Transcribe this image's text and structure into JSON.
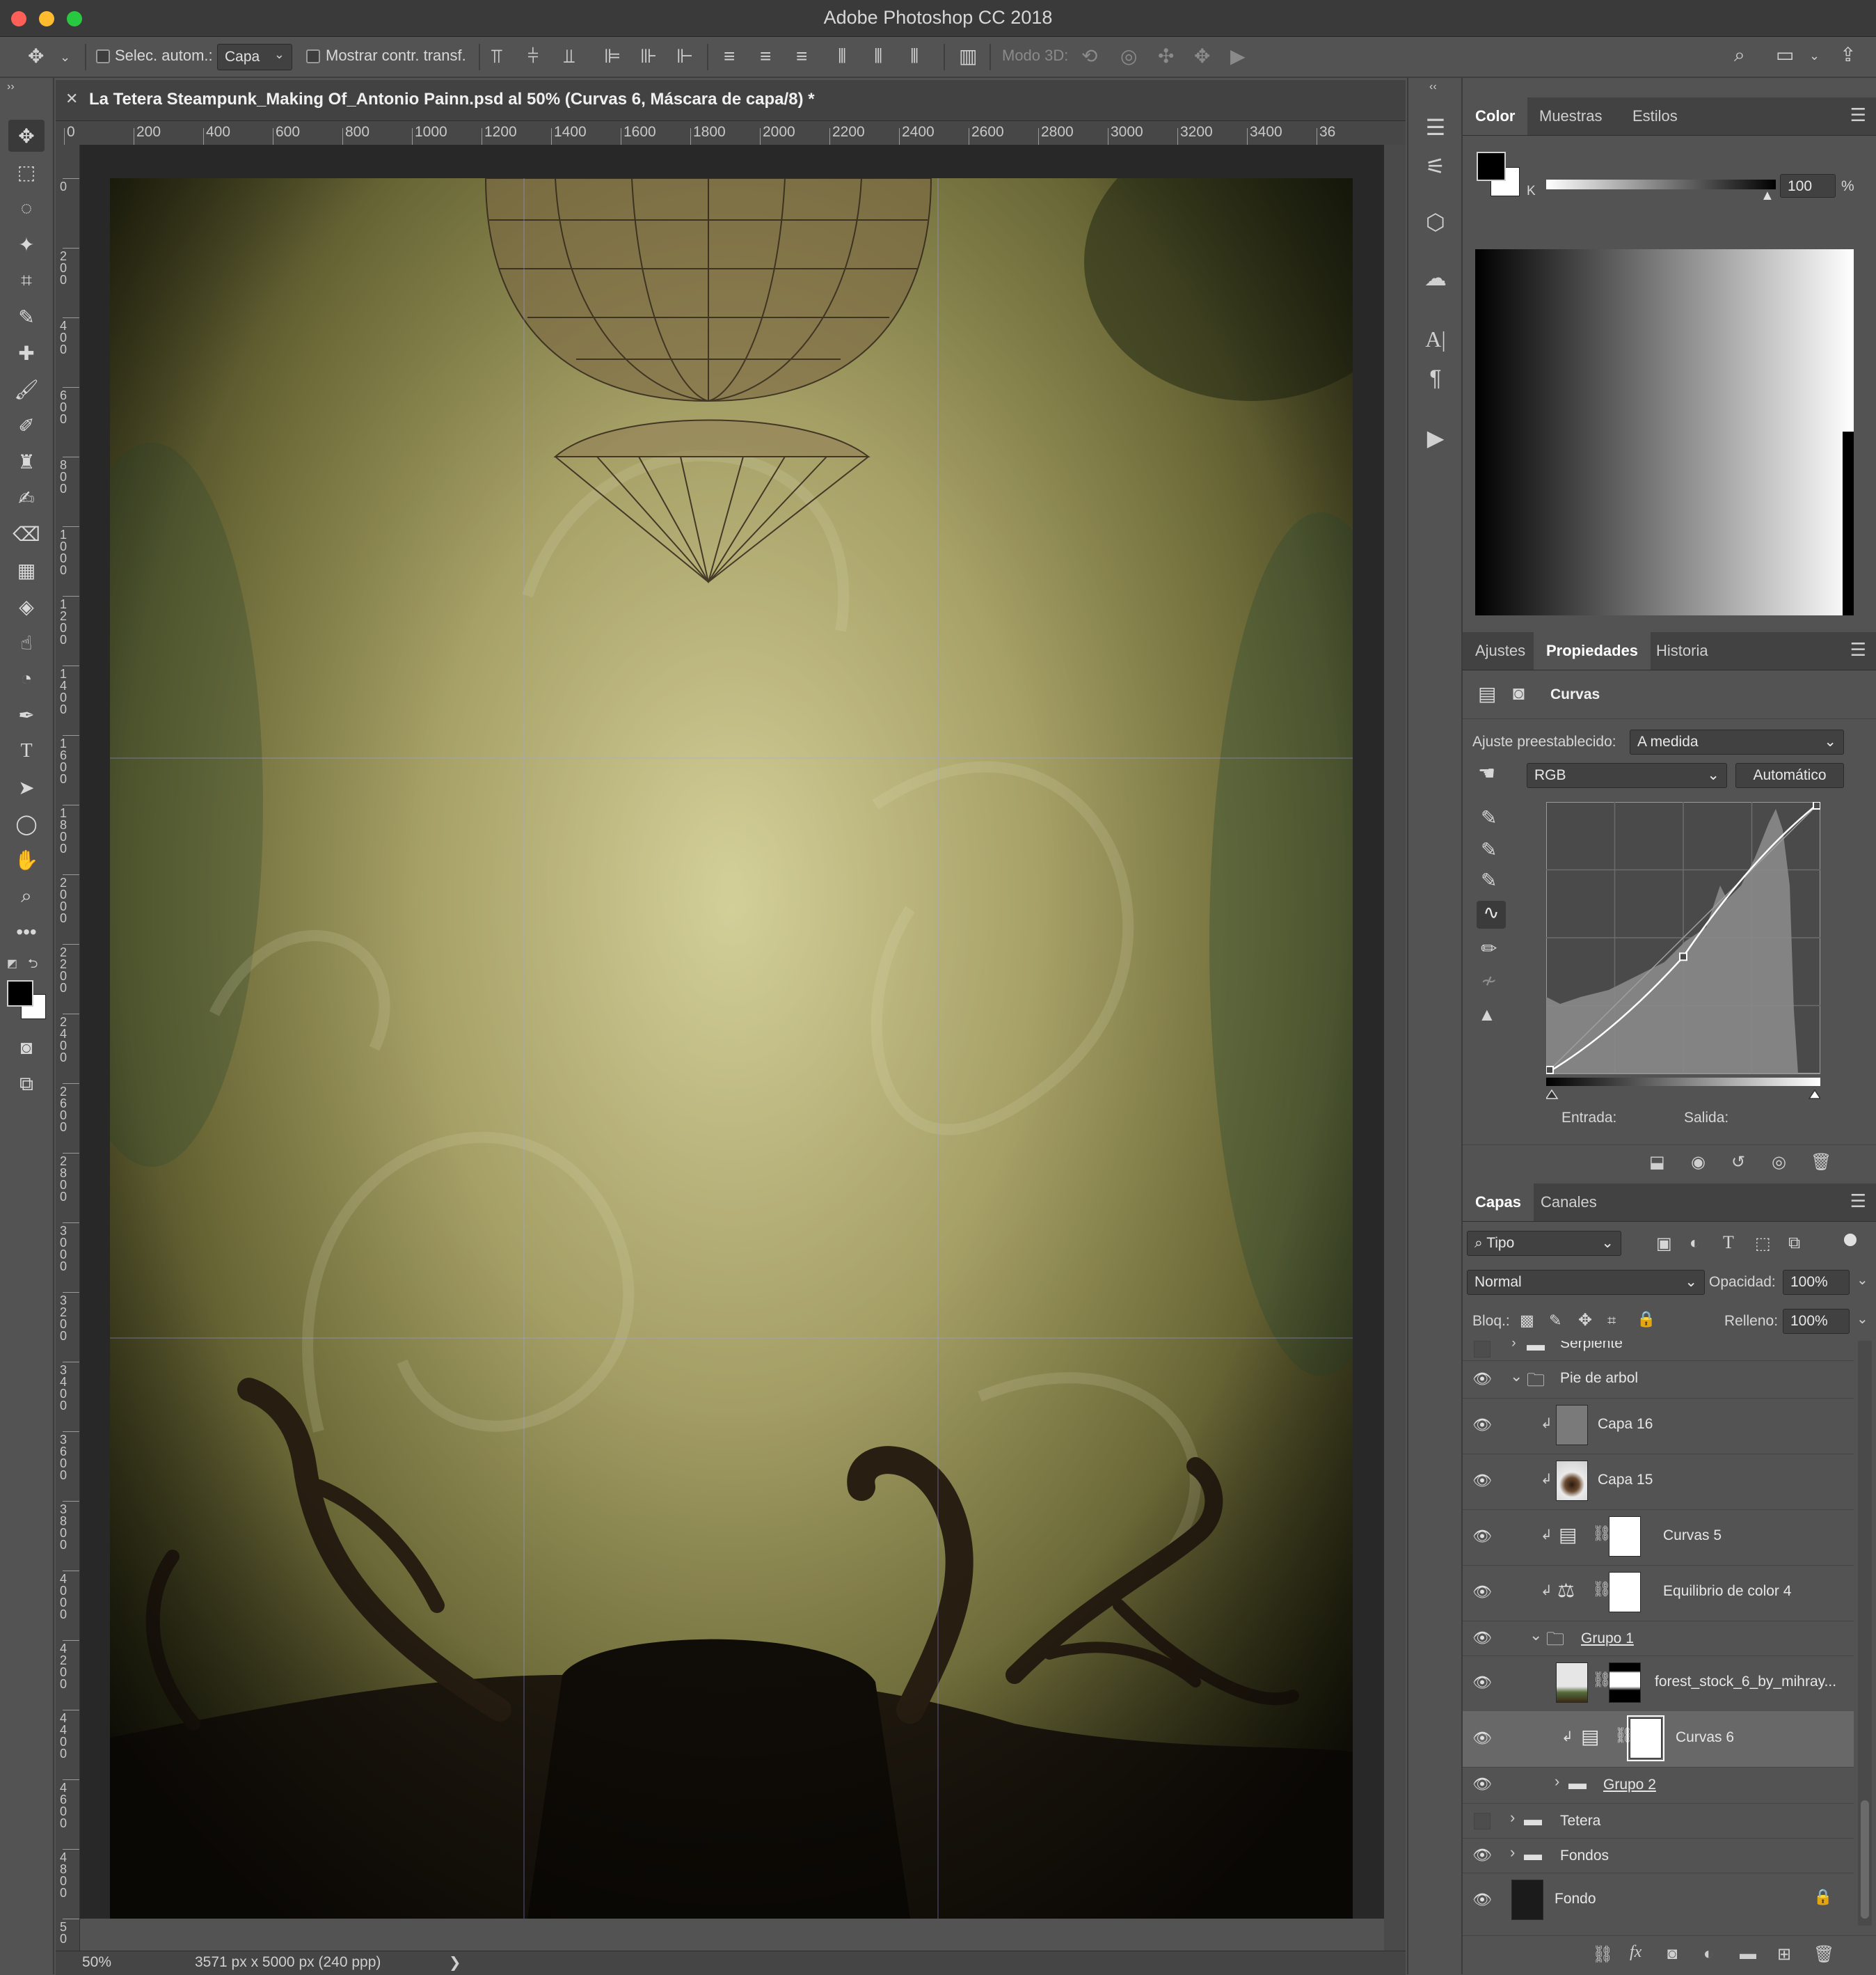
{
  "window": {
    "title": "Adobe Photoshop CC 2018"
  },
  "options_bar": {
    "auto_select_label": "Selec. autom.:",
    "auto_select_value": "Capa",
    "show_transform_label": "Mostrar contr. transf.",
    "mode_3d_label": "Modo 3D:"
  },
  "document": {
    "tab_title": "La Tetera Steampunk_Making Of_Antonio Painn.psd al 50% (Curvas 6, Máscara de capa/8) *",
    "ruler_h": [
      "0",
      "200",
      "400",
      "600",
      "800",
      "1000",
      "1200",
      "1400",
      "1600",
      "1800",
      "2000",
      "2200",
      "2400",
      "2600",
      "2800",
      "3000",
      "3200",
      "3400",
      "36"
    ],
    "ruler_v": [
      "0",
      "2 0 0",
      "4 0 0",
      "6 0 0",
      "8 0 0",
      "1 0 0 0",
      "1 2 0 0",
      "1 4 0 0",
      "1 6 0 0",
      "1 8 0 0",
      "2 0 0 0",
      "2 2 0 0",
      "2 4 0 0",
      "2 6 0 0",
      "2 8 0 0",
      "3 0 0 0",
      "3 2 0 0",
      "3 4 0 0",
      "3 6 0 0",
      "3 8 0 0",
      "4 0 0 0",
      "4 2 0 0",
      "4 4 0 0",
      "4 6 0 0",
      "4 8 0 0",
      "5 0"
    ],
    "zoom": "50%",
    "doc_info": "3571 px x 5000 px (240 ppp)"
  },
  "color_panel": {
    "tabs": [
      "Color",
      "Muestras",
      "Estilos"
    ],
    "active_tab": "Color",
    "channel_label": "K",
    "value": "100",
    "unit": "%",
    "foreground": "#000000",
    "background": "#ffffff"
  },
  "properties_panel": {
    "tabs": [
      "Ajustes",
      "Propiedades",
      "Historia"
    ],
    "active_tab": "Propiedades",
    "title": "Curvas",
    "preset_label": "Ajuste preestablecido:",
    "preset_value": "A medida",
    "channel_value": "RGB",
    "auto_button": "Automático",
    "input_label": "Entrada:",
    "output_label": "Salida:",
    "curve_points": [
      [
        0.0,
        0.0
      ],
      [
        0.5,
        0.43
      ],
      [
        1.0,
        1.0
      ]
    ]
  },
  "layers_panel": {
    "tabs": [
      "Capas",
      "Canales"
    ],
    "active_tab": "Capas",
    "filter_value": "Tipo",
    "blend_mode": "Normal",
    "opacity_label": "Opacidad:",
    "opacity_value": "100%",
    "lock_label": "Bloq.:",
    "fill_label": "Relleno:",
    "fill_value": "100%",
    "layers": [
      {
        "name": "Serpiente",
        "visible": false,
        "kind": "group-collapsed"
      },
      {
        "name": "Pie de arbol",
        "visible": true,
        "kind": "group-open"
      },
      {
        "name": "Capa 16",
        "visible": true,
        "kind": "pixel-clipped"
      },
      {
        "name": "Capa 15",
        "visible": true,
        "kind": "pixel-clipped"
      },
      {
        "name": "Curvas 5",
        "visible": true,
        "kind": "curves-clipped"
      },
      {
        "name": "Equilibrio de color 4",
        "visible": true,
        "kind": "balance-clipped"
      },
      {
        "name": "Grupo 1",
        "visible": true,
        "kind": "group-open"
      },
      {
        "name": "forest_stock_6_by_mihray...",
        "visible": true,
        "kind": "pixel-mask"
      },
      {
        "name": "Curvas 6",
        "visible": true,
        "kind": "curves-clipped",
        "selected": true
      },
      {
        "name": "Grupo 2",
        "visible": true,
        "kind": "group-collapsed"
      },
      {
        "name": "Tetera",
        "visible": false,
        "kind": "group-collapsed"
      },
      {
        "name": "Fondos",
        "visible": true,
        "kind": "group-collapsed"
      },
      {
        "name": "Fondo",
        "visible": true,
        "kind": "background-locked"
      }
    ]
  }
}
